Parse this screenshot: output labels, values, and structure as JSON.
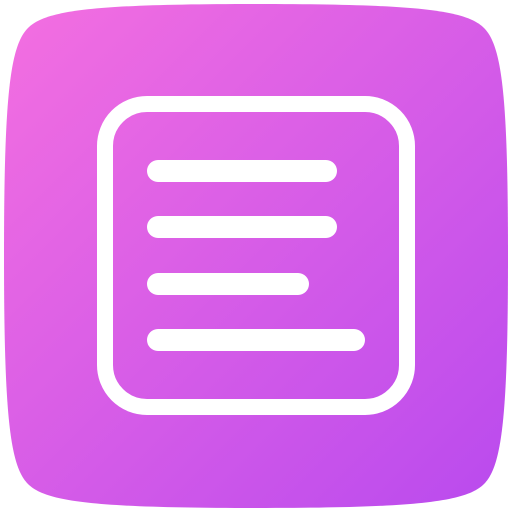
{
  "icon": {
    "name": "notes-app-icon",
    "glyph": "text-lines-document-icon",
    "colors": {
      "gradient_start": "#F46FE0",
      "gradient_end": "#B94AEE",
      "glyph": "#FFFFFF"
    },
    "text_lines": 4
  }
}
